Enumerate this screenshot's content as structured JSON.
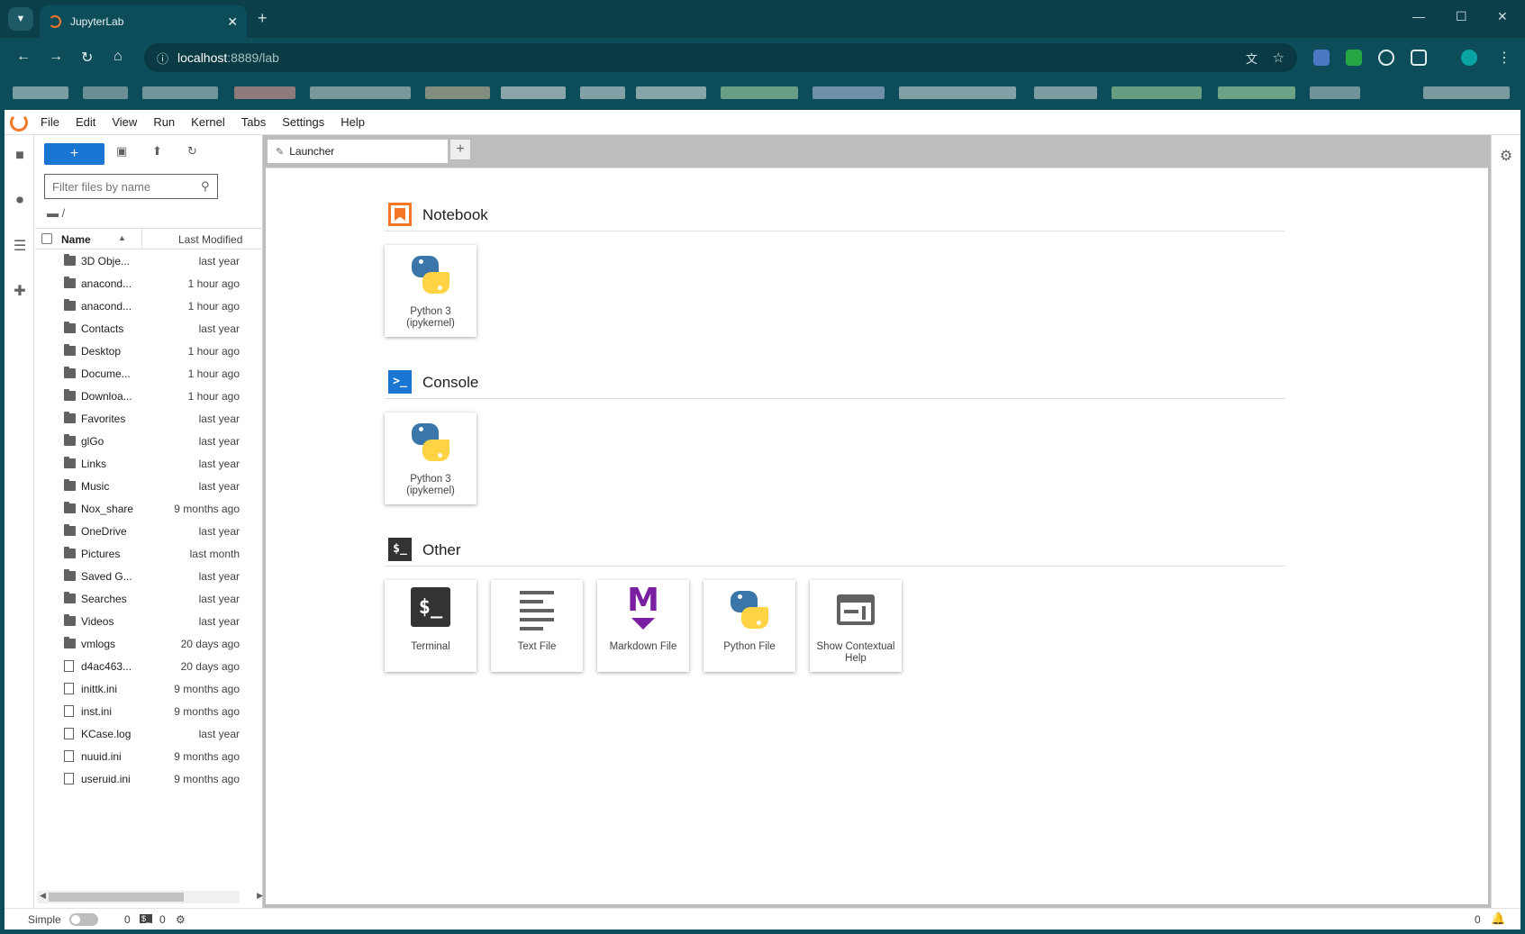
{
  "browser": {
    "tab_title": "JupyterLab",
    "url_host": "localhost",
    "url_path": ":8889/lab"
  },
  "app": {
    "menus": [
      "File",
      "Edit",
      "View",
      "Run",
      "Kernel",
      "Tabs",
      "Settings",
      "Help"
    ]
  },
  "file_browser": {
    "new_label": "+",
    "filter_placeholder": "Filter files by name",
    "breadcrumb": "/",
    "col_name": "Name",
    "col_modified": "Last Modified",
    "items": [
      {
        "name": "3D Obje...",
        "modified": "last year",
        "type": "folder"
      },
      {
        "name": "anacond...",
        "modified": "1 hour ago",
        "type": "folder"
      },
      {
        "name": "anacond...",
        "modified": "1 hour ago",
        "type": "folder"
      },
      {
        "name": "Contacts",
        "modified": "last year",
        "type": "folder"
      },
      {
        "name": "Desktop",
        "modified": "1 hour ago",
        "type": "folder"
      },
      {
        "name": "Docume...",
        "modified": "1 hour ago",
        "type": "folder"
      },
      {
        "name": "Downloa...",
        "modified": "1 hour ago",
        "type": "folder"
      },
      {
        "name": "Favorites",
        "modified": "last year",
        "type": "folder"
      },
      {
        "name": "glGo",
        "modified": "last year",
        "type": "folder"
      },
      {
        "name": "Links",
        "modified": "last year",
        "type": "folder"
      },
      {
        "name": "Music",
        "modified": "last year",
        "type": "folder"
      },
      {
        "name": "Nox_share",
        "modified": "9 months ago",
        "type": "folder"
      },
      {
        "name": "OneDrive",
        "modified": "last year",
        "type": "folder"
      },
      {
        "name": "Pictures",
        "modified": "last month",
        "type": "folder"
      },
      {
        "name": "Saved G...",
        "modified": "last year",
        "type": "folder"
      },
      {
        "name": "Searches",
        "modified": "last year",
        "type": "folder"
      },
      {
        "name": "Videos",
        "modified": "last year",
        "type": "folder"
      },
      {
        "name": "vmlogs",
        "modified": "20 days ago",
        "type": "folder"
      },
      {
        "name": "d4ac463...",
        "modified": "20 days ago",
        "type": "file"
      },
      {
        "name": "inittk.ini",
        "modified": "9 months ago",
        "type": "file"
      },
      {
        "name": "inst.ini",
        "modified": "9 months ago",
        "type": "file"
      },
      {
        "name": "KCase.log",
        "modified": "last year",
        "type": "file"
      },
      {
        "name": "nuuid.ini",
        "modified": "9 months ago",
        "type": "file"
      },
      {
        "name": "useruid.ini",
        "modified": "9 months ago",
        "type": "file"
      }
    ]
  },
  "main": {
    "tab_label": "Launcher",
    "sections": [
      {
        "title": "Notebook",
        "cards": [
          {
            "label": "Python 3 (ipykernel)",
            "icon": "python-icon"
          }
        ]
      },
      {
        "title": "Console",
        "cards": [
          {
            "label": "Python 3 (ipykernel)",
            "icon": "python-icon"
          }
        ]
      },
      {
        "title": "Other",
        "cards": [
          {
            "label": "Terminal",
            "icon": "terminal-icon"
          },
          {
            "label": "Text File",
            "icon": "text-file-icon"
          },
          {
            "label": "Markdown File",
            "icon": "markdown-icon"
          },
          {
            "label": "Python File",
            "icon": "python-icon"
          },
          {
            "label": "Show Contextual Help",
            "icon": "contextual-help-icon"
          }
        ]
      }
    ]
  },
  "status": {
    "mode_label": "Simple",
    "kernels_count": "0",
    "terminals_count": "0",
    "notifications_count": "0"
  },
  "colors": {
    "browser_chrome": "#0d4d59",
    "accent": "#1976d2",
    "jupyter_orange": "#f37726",
    "markdown_purple": "#7b1fa2"
  }
}
